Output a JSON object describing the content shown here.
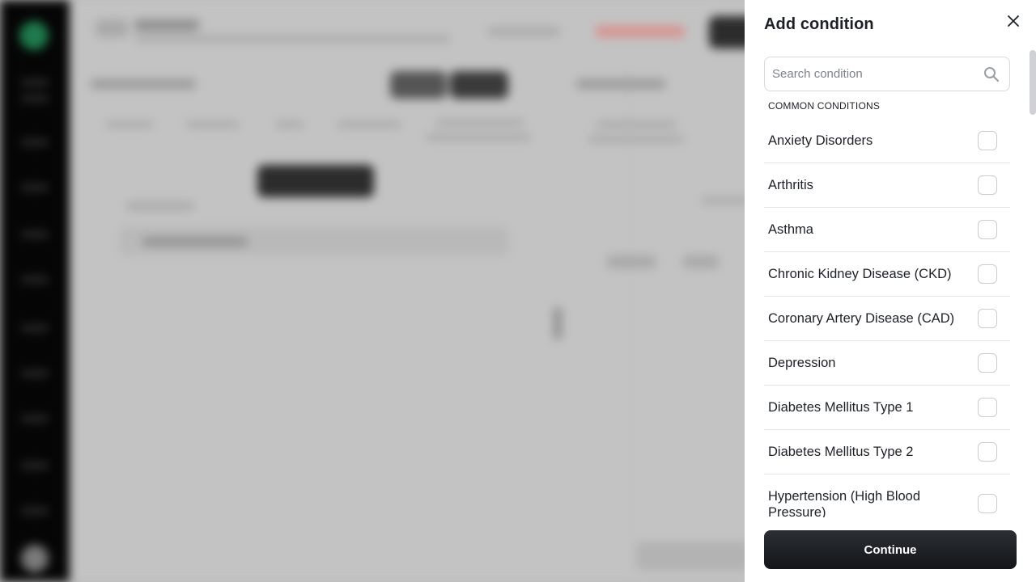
{
  "dialog": {
    "title": "Add condition",
    "search_placeholder": "Search condition",
    "section_label": "COMMON CONDITIONS",
    "conditions": [
      {
        "label": "Anxiety Disorders",
        "checked": false
      },
      {
        "label": "Arthritis",
        "checked": false
      },
      {
        "label": "Asthma",
        "checked": false
      },
      {
        "label": "Chronic Kidney Disease (CKD)",
        "checked": false
      },
      {
        "label": "Coronary Artery Disease (CAD)",
        "checked": false
      },
      {
        "label": "Depression",
        "checked": false
      },
      {
        "label": "Diabetes Mellitus Type 1",
        "checked": false
      },
      {
        "label": "Diabetes Mellitus Type 2",
        "checked": false
      },
      {
        "label": "Hypertension (High Blood Pressure)",
        "checked": false
      }
    ],
    "continue_label": "Continue"
  },
  "icons": {
    "close": "close-icon",
    "search": "search-icon"
  },
  "colors": {
    "text": "#1d2127",
    "button": "#1a1c20",
    "border": "#d6d8dc"
  }
}
